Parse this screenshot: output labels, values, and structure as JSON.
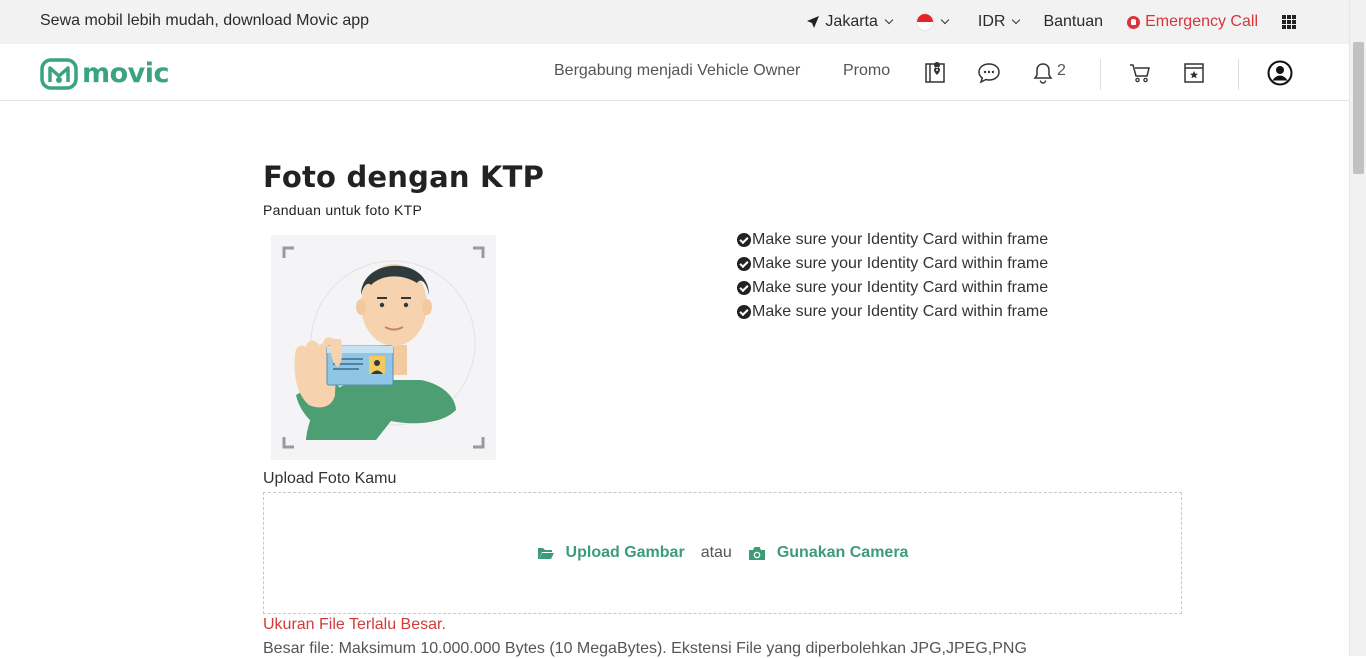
{
  "topbar": {
    "promo_text": "Sewa mobil lebih mudah, download Movic app",
    "location": "Jakarta",
    "language_icon": "indonesia-flag",
    "currency": "IDR",
    "help": "Bantuan",
    "emergency": "Emergency Call",
    "apps_icon": "grid-icon"
  },
  "nav": {
    "logo_text": "movic",
    "become_owner": "Bergabung menjadi Vehicle Owner",
    "promo": "Promo",
    "notification_count": "2",
    "icons": [
      "map-book-icon",
      "chat-icon",
      "bell-icon",
      "cart-icon",
      "ticket-icon",
      "user-icon"
    ]
  },
  "page": {
    "title": "Foto dengan KTP",
    "subtitle": "Panduan untuk foto KTP",
    "checklist": [
      "Make sure your Identity Card within frame",
      "Make sure your Identity Card within frame",
      "Make sure your Identity Card within frame",
      "Make sure your Identity Card within frame"
    ],
    "upload_label": "Upload Foto Kamu",
    "upload_button": "Upload Gambar",
    "or_text": "atau",
    "camera_button": "Gunakan Camera",
    "error_text": "Ukuran File Terlalu Besar.",
    "file_note": "Besar file: Maksimum 10.000.000 Bytes (10 MegaBytes). Ekstensi File yang diperbolehkan JPG,JPEG,PNG"
  },
  "colors": {
    "brand": "#3aa47e",
    "action": "#3e9b78",
    "error": "#d23b3b",
    "emergency": "#d9343b"
  }
}
